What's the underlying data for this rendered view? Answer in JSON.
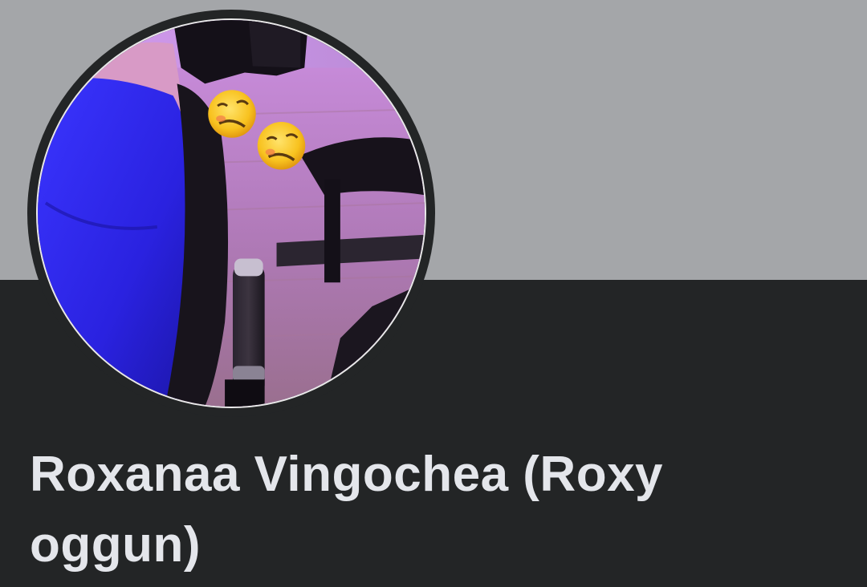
{
  "profile": {
    "name": "Roxanaa Vingochea (Roxy oggun)",
    "profile_picture_icons": [
      "woozy-face-emoji-icon",
      "woozy-face-emoji-icon"
    ]
  },
  "colors": {
    "cover_background": "#a4a6a9",
    "page_background": "#232526",
    "name_text": "#e4e6eb"
  }
}
